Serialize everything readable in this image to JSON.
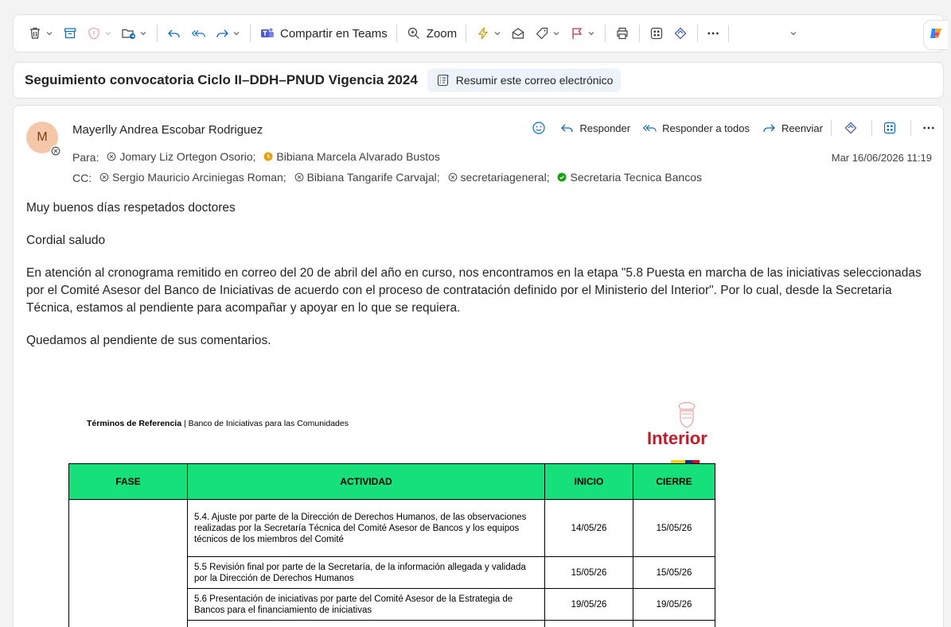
{
  "toolbar": {
    "teams_label": "Compartir en Teams",
    "zoom_label": "Zoom",
    "more_label": "⋯"
  },
  "subject": {
    "title": "Seguimiento convocatoria Ciclo II–DDH–PNUD Vigencia 2024",
    "summarize_label": "Resumir este correo electrónico"
  },
  "message": {
    "avatar_initial": "M",
    "sender": "Mayerlly Andrea Escobar Rodriguez",
    "to_label": "Para:",
    "to": [
      {
        "name": "Jomary Liz Ortegon Osorio;",
        "status": "offline"
      },
      {
        "name": "Bibiana Marcela Alvarado Bustos",
        "status": "away"
      }
    ],
    "cc_label": "CC:",
    "cc": [
      {
        "name": "Sergio Mauricio Arciniegas Roman;",
        "status": "offline"
      },
      {
        "name": "Bibiana Tangarife Carvajal;",
        "status": "offline"
      },
      {
        "name": "secretariageneral;",
        "status": "offline"
      },
      {
        "name": "Secretaria Tecnica Bancos",
        "status": "available"
      }
    ],
    "date": "Mar 16/06/2026 11:19",
    "actions": {
      "reply": "Responder",
      "reply_all": "Responder a todos",
      "forward": "Reenviar",
      "more": "⋯"
    },
    "body": {
      "p1": "Muy buenos días respetados doctores",
      "p2": "Cordial saludo",
      "p3": "En atención al cronograma remitido en correo del 20 de abril del año en curso, nos encontramos en la etapa \"5.8  Puesta en marcha de las iniciativas seleccionadas por el Comité Asesor del Banco de Iniciativas de acuerdo con el proceso de contratación definido por el Ministerio del Interior\". Por lo cual, desde la Secretaria Técnica, estamos al pendiente para acompañar y apoyar en lo que se requiera.",
      "p4": "Quedamos al pendiente de sus comentarios."
    }
  },
  "attachment": {
    "header_bold": "Términos de Referencia",
    "header_rest": " | Banco de Iniciativas para las Comunidades",
    "logo_text": "Interior",
    "columns": [
      "FASE",
      "ACTIVIDAD",
      "INICIO",
      "CIERRE"
    ],
    "rows": [
      {
        "actividad": "5.4. Ajuste por parte de la Dirección de Derechos Humanos, de las observaciones realizadas por la Secretaría Técnica del Comité Asesor de Bancos y los equipos técnicos de los miembros del Comité",
        "inicio": "14/05/26",
        "cierre": "15/05/26"
      },
      {
        "actividad": "5.5 Revisión final por parte de la Secretaría, de la información allegada y validada por la Dirección de Derechos Humanos",
        "inicio": "15/05/26",
        "cierre": "15/05/26"
      },
      {
        "actividad": "5.6 Presentación de iniciativas por parte del Comité Asesor de la Estrategia de Bancos para el financiamiento de iniciativas",
        "inicio": "19/05/26",
        "cierre": "19/05/26"
      }
    ]
  },
  "colors": {
    "accent": "#0f6cbd",
    "table_header": "#15e07a",
    "logo_red": "#c01d2b",
    "available": "#13a10e",
    "away": "#e6a117"
  }
}
